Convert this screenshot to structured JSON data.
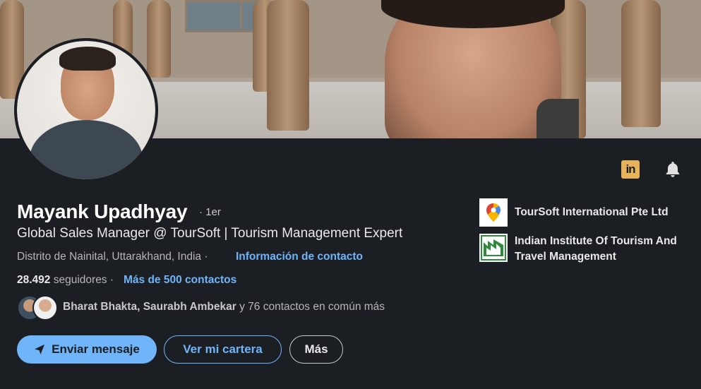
{
  "profile": {
    "name": "Mayank Upadhyay",
    "degree": "· 1er",
    "headline": "Global Sales Manager @ TourSoft | Tourism Management Expert",
    "location": "Distrito de Nainital, Uttarakhand, India",
    "separator": "·",
    "contact_info_link": "Información de contacto",
    "followers_count": "28.492",
    "followers_label": "seguidores",
    "connections_link": "Más de 500 contactos",
    "mutual_names": "Bharat Bhakta, Saurabh Ambekar",
    "mutual_suffix": "y 76 contactos en común más"
  },
  "actions": {
    "message_label": "Enviar mensaje",
    "portfolio_label": "Ver mi cartera",
    "more_label": "Más"
  },
  "organizations": [
    {
      "name": "TourSoft International Pte Ltd"
    },
    {
      "name": "Indian Institute Of Tourism And Travel Management"
    }
  ],
  "icons": {
    "linkedin_badge": "in",
    "bell": "bell-icon"
  },
  "colors": {
    "background": "#1b1f23",
    "accent": "#70b5f9",
    "linkedin_badge": "#e6b35a"
  }
}
